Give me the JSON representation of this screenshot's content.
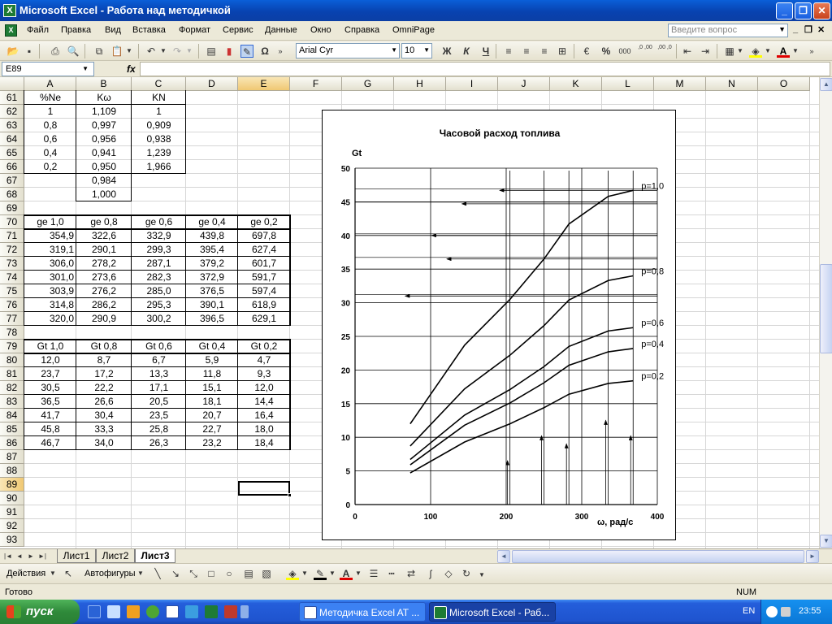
{
  "window": {
    "app_icon": "X",
    "title": "Microsoft Excel - Работа над методичкой",
    "min_label": "_",
    "max_label": "❐",
    "close_label": "✕"
  },
  "menu": {
    "items": [
      "Файл",
      "Правка",
      "Вид",
      "Вставка",
      "Формат",
      "Сервис",
      "Данные",
      "Окно",
      "Справка",
      "OmniPage"
    ],
    "help_placeholder": "Введите вопрос",
    "doc_min": "_",
    "doc_restore": "❐",
    "doc_close": "✕"
  },
  "toolbar": {
    "font_name": "Arial Cyr",
    "font_size": "10",
    "bold": "Ж",
    "italic": "К",
    "underline": "Ч",
    "percent": "%",
    "thousands": "000",
    "inc_decimal": ",0 ,00",
    "dec_decimal": ",00 ,0",
    "omega": "Ω"
  },
  "formula": {
    "cell_ref": "E89",
    "fx": "fx",
    "value": ""
  },
  "columns": [
    "A",
    "B",
    "C",
    "D",
    "E",
    "F",
    "G",
    "H",
    "I",
    "J",
    "K",
    "L",
    "M",
    "N",
    "O"
  ],
  "selected_column": "E",
  "rows": [
    "61",
    "62",
    "63",
    "64",
    "65",
    "66",
    "67",
    "68",
    "69",
    "70",
    "71",
    "72",
    "73",
    "74",
    "75",
    "76",
    "77",
    "78",
    "79",
    "80",
    "81",
    "82",
    "83",
    "84",
    "85",
    "86",
    "87",
    "88",
    "89",
    "90",
    "91",
    "92",
    "93"
  ],
  "selected_row": "89",
  "table1": {
    "headers": [
      "%Ne",
      "Kω",
      "KN"
    ],
    "rows": [
      [
        "1",
        "1,109",
        "1"
      ],
      [
        "0,8",
        "0,997",
        "0,909"
      ],
      [
        "0,6",
        "0,956",
        "0,938"
      ],
      [
        "0,4",
        "0,941",
        "1,239"
      ],
      [
        "0,2",
        "0,950",
        "1,966"
      ],
      [
        "",
        "0,984",
        ""
      ],
      [
        "",
        "1,000",
        ""
      ]
    ]
  },
  "table2": {
    "headers": [
      "ge 1,0",
      "ge 0,8",
      "ge 0,6",
      "ge 0,4",
      "ge 0,2"
    ],
    "rows": [
      [
        "354,9",
        "322,6",
        "332,9",
        "439,8",
        "697,8"
      ],
      [
        "319,1",
        "290,1",
        "299,3",
        "395,4",
        "627,4"
      ],
      [
        "306,0",
        "278,2",
        "287,1",
        "379,2",
        "601,7"
      ],
      [
        "301,0",
        "273,6",
        "282,3",
        "372,9",
        "591,7"
      ],
      [
        "303,9",
        "276,2",
        "285,0",
        "376,5",
        "597,4"
      ],
      [
        "314,8",
        "286,2",
        "295,3",
        "390,1",
        "618,9"
      ],
      [
        "320,0",
        "290,9",
        "300,2",
        "396,5",
        "629,1"
      ]
    ]
  },
  "table3": {
    "headers": [
      "Gt 1,0",
      "Gt 0,8",
      "Gt 0,6",
      "Gt 0,4",
      "Gt 0,2"
    ],
    "rows": [
      [
        "12,0",
        "8,7",
        "6,7",
        "5,9",
        "4,7"
      ],
      [
        "23,7",
        "17,2",
        "13,3",
        "11,8",
        "9,3"
      ],
      [
        "30,5",
        "22,2",
        "17,1",
        "15,1",
        "12,0"
      ],
      [
        "36,5",
        "26,6",
        "20,5",
        "18,1",
        "14,4"
      ],
      [
        "41,7",
        "30,4",
        "23,5",
        "20,7",
        "16,4"
      ],
      [
        "45,8",
        "33,3",
        "25,8",
        "22,7",
        "18,0"
      ],
      [
        "46,7",
        "34,0",
        "26,3",
        "23,2",
        "18,4"
      ]
    ]
  },
  "chart_data": {
    "type": "line",
    "title": "Часовой расход топлива",
    "ylabel": "Gt",
    "xlabel": "ω, рад/с",
    "xlim": [
      0,
      400
    ],
    "ylim": [
      0,
      50
    ],
    "xticks": [
      "0",
      "100",
      "200",
      "300",
      "400"
    ],
    "yticks": [
      "0",
      "5",
      "10",
      "15",
      "20",
      "25",
      "30",
      "35",
      "40",
      "45",
      "50"
    ],
    "grid": true,
    "x": [
      73,
      145,
      205,
      250,
      283,
      335,
      368
    ],
    "series": [
      {
        "name": "p=1,0",
        "values": [
          12.0,
          23.7,
          30.5,
          36.5,
          41.7,
          45.8,
          46.7
        ]
      },
      {
        "name": "p=0,8",
        "values": [
          8.7,
          17.2,
          22.2,
          26.6,
          30.4,
          33.3,
          34.0
        ]
      },
      {
        "name": "p=0,6",
        "values": [
          6.7,
          13.3,
          17.1,
          20.5,
          23.5,
          25.8,
          26.3
        ]
      },
      {
        "name": "p=0,4",
        "values": [
          5.9,
          11.8,
          15.1,
          18.1,
          20.7,
          22.7,
          23.2
        ]
      },
      {
        "name": "p=0,2",
        "values": [
          4.7,
          9.3,
          12.0,
          14.4,
          16.4,
          18.0,
          18.4
        ]
      }
    ],
    "left_arrows": [
      {
        "x_to": 200,
        "y": 46.7
      },
      {
        "x_to": 150,
        "y": 44.7
      },
      {
        "x_to": 110,
        "y": 40.0
      },
      {
        "x_to": 130,
        "y": 36.5
      },
      {
        "x_to": 75,
        "y": 31.0
      }
    ],
    "up_arrows": [
      {
        "x": 205,
        "y": 7.5
      },
      {
        "x": 250,
        "y": 11.2
      },
      {
        "x": 283,
        "y": 10.0
      },
      {
        "x": 335,
        "y": 13.5
      },
      {
        "x": 368,
        "y": 11.2
      }
    ]
  },
  "sheets": {
    "tabs": [
      "Лист1",
      "Лист2",
      "Лист3"
    ],
    "active": "Лист3"
  },
  "drawing_toolbar": {
    "actions": "Действия",
    "autoshapes": "Автофигуры"
  },
  "status": {
    "ready": "Готово",
    "num": "NUM"
  },
  "taskbar": {
    "start": "пуск",
    "tasks": [
      "Методичка Excel AT ...",
      "Microsoft Excel - Раб..."
    ],
    "lang": "EN",
    "clock": "23:55"
  }
}
